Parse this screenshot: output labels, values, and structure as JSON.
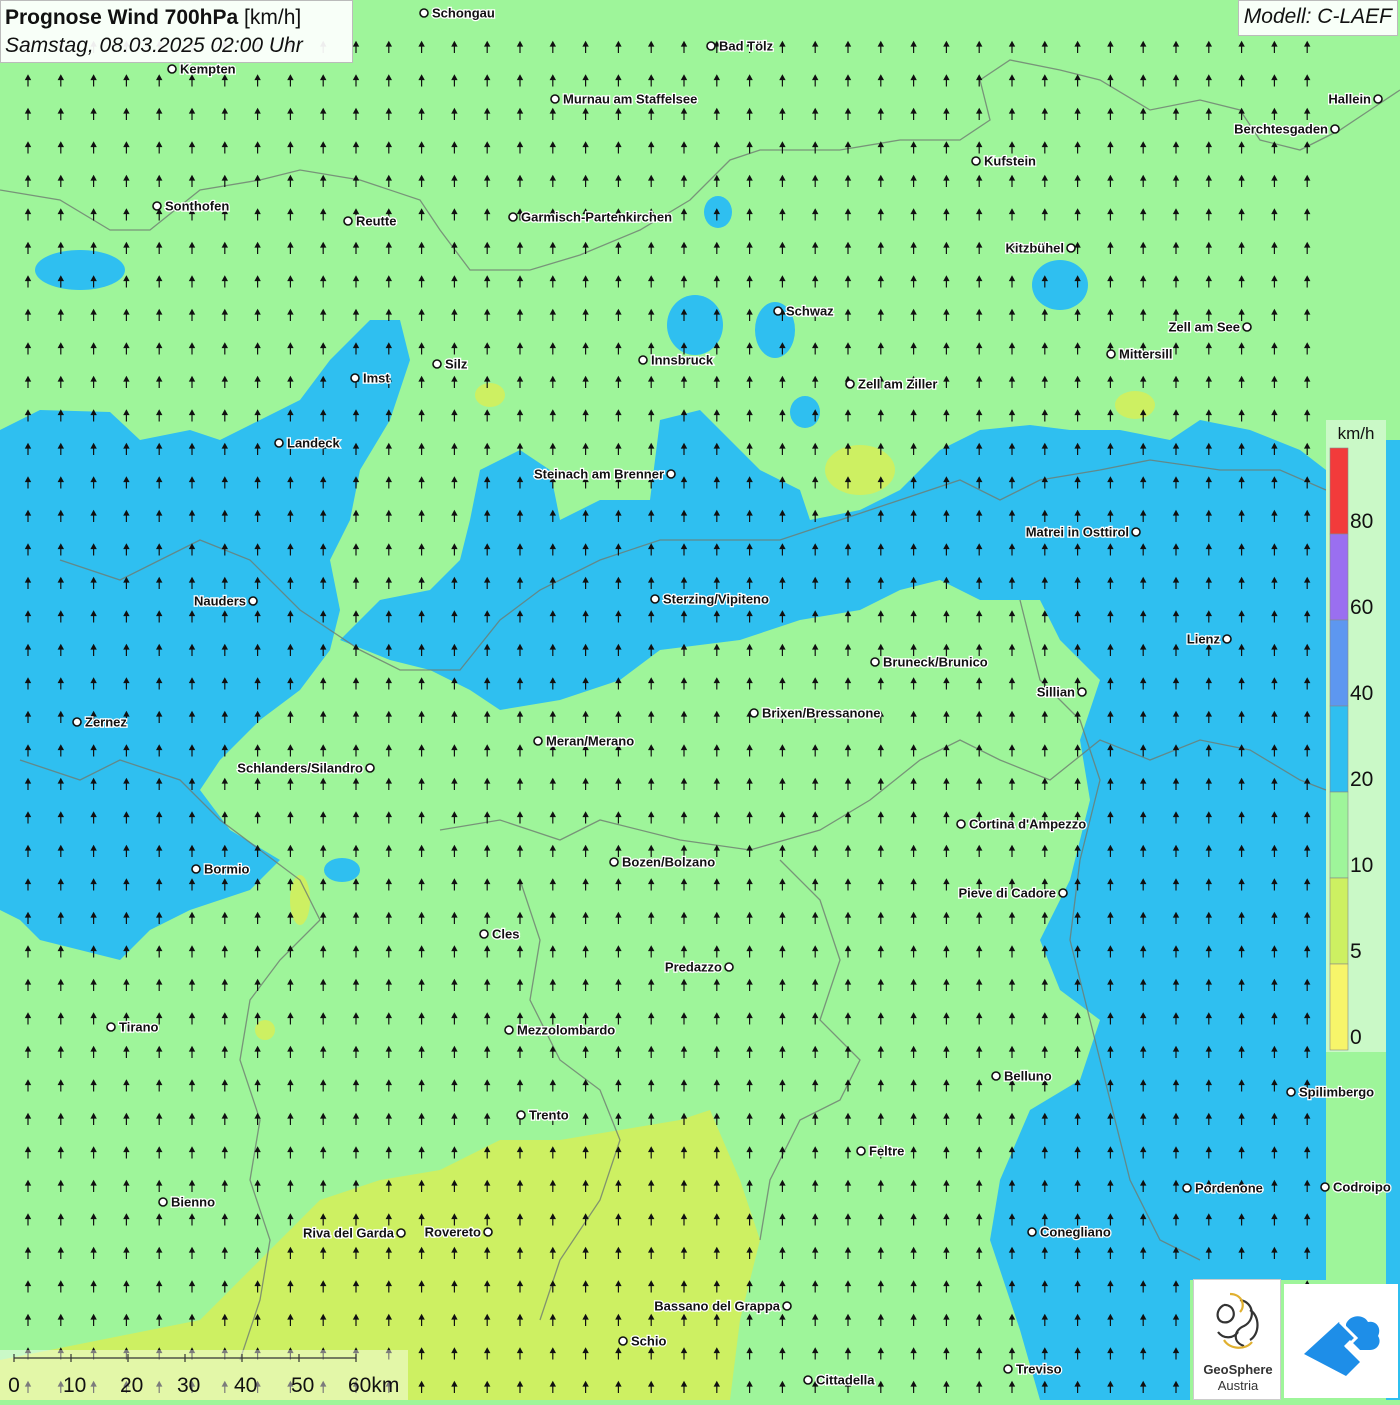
{
  "header": {
    "title_bold": "Prognose Wind 700hPa",
    "title_unit": "[km/h]",
    "subtitle": "Samstag, 08.03.2025 02:00 Uhr",
    "model": "Modell: C-LAEF"
  },
  "legend": {
    "unit": "km/h",
    "labels": [
      "80",
      "60",
      "40",
      "20",
      "10",
      "5",
      "0"
    ],
    "colors": [
      "#f23b3b",
      "#9a6ff0",
      "#5d97f0",
      "#2fbff0",
      "#9ef59a",
      "#cdf062",
      "#f7f56a"
    ]
  },
  "scale": {
    "labels": [
      "0",
      "10",
      "20",
      "30",
      "40",
      "50",
      "60km"
    ]
  },
  "logos": {
    "geosphere_line1": "GeoSphere",
    "geosphere_line2": "Austria"
  },
  "map": {
    "wind_direction": "north",
    "zone_colors": {
      "low": "#cdf062",
      "mid": "#9ef59a",
      "high": "#2fbff0"
    },
    "cities": [
      {
        "name": "Schongau"
      },
      {
        "name": "Bad Tölz"
      },
      {
        "name": "Kempten"
      },
      {
        "name": "Murnau am Staffelsee"
      },
      {
        "name": "Hallein"
      },
      {
        "name": "Berchtesgaden"
      },
      {
        "name": "Kufstein"
      },
      {
        "name": "Sonthofen"
      },
      {
        "name": "Reutte"
      },
      {
        "name": "Garmisch-Partenkirchen"
      },
      {
        "name": "Kitzbühel"
      },
      {
        "name": "Schwaz"
      },
      {
        "name": "Zell am See"
      },
      {
        "name": "Innsbruck"
      },
      {
        "name": "Mittersill"
      },
      {
        "name": "Imst"
      },
      {
        "name": "Silz"
      },
      {
        "name": "Zell am Ziller"
      },
      {
        "name": "Landeck"
      },
      {
        "name": "Steinach am Brenner"
      },
      {
        "name": "Matrei in Osttirol"
      },
      {
        "name": "Nauders"
      },
      {
        "name": "Sterzing/Vipiteno"
      },
      {
        "name": "Lienz"
      },
      {
        "name": "Bruneck/Brunico"
      },
      {
        "name": "Sillian"
      },
      {
        "name": "Zernez"
      },
      {
        "name": "Brixen/Bressanone"
      },
      {
        "name": "Meran/Merano"
      },
      {
        "name": "Schlanders/Silandro"
      },
      {
        "name": "Cortina d'Ampezzo"
      },
      {
        "name": "Bozen/Bolzano"
      },
      {
        "name": "Bormio"
      },
      {
        "name": "Pieve di Cadore"
      },
      {
        "name": "Cles"
      },
      {
        "name": "Predazzo"
      },
      {
        "name": "Tirano"
      },
      {
        "name": "Mezzolombardo"
      },
      {
        "name": "Belluno"
      },
      {
        "name": "Spilimbergo"
      },
      {
        "name": "Trento"
      },
      {
        "name": "Feltre"
      },
      {
        "name": "Pordenone"
      },
      {
        "name": "Codroipo"
      },
      {
        "name": "Bienno"
      },
      {
        "name": "Riva del Garda"
      },
      {
        "name": "Rovereto"
      },
      {
        "name": "Conegliano"
      },
      {
        "name": "Bassano del Grappa"
      },
      {
        "name": "Schio"
      },
      {
        "name": "Treviso"
      },
      {
        "name": "Cittadella"
      }
    ]
  }
}
